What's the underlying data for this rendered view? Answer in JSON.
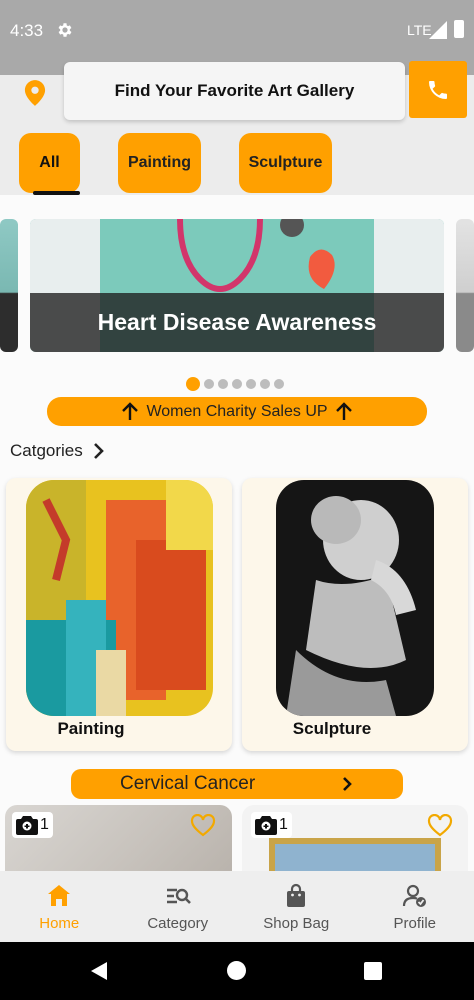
{
  "status_bar": {
    "time": "4:33",
    "network": "LTE"
  },
  "header": {
    "search_placeholder": "Find Your Favorite Art Gallery"
  },
  "filters": {
    "chips": [
      "All",
      "Painting",
      "Sculpture"
    ],
    "selected": "All"
  },
  "banner": {
    "title": "Heart Disease Awareness",
    "slide_count": 7,
    "active_slide": 1
  },
  "charity_button": {
    "label": "Women Charity Sales UP"
  },
  "categories": {
    "heading": "Catgories",
    "items": [
      {
        "label": "Painting"
      },
      {
        "label": "Sculpture"
      }
    ]
  },
  "cervical_button": {
    "label": "Cervical Cancer"
  },
  "products": [
    {
      "photo_count": "1",
      "favorite": false
    },
    {
      "photo_count": "1",
      "favorite": false
    }
  ],
  "bottom_nav": {
    "items": [
      {
        "label": "Home",
        "icon": "home-icon",
        "active": true
      },
      {
        "label": "Category",
        "icon": "category-search-icon",
        "active": false
      },
      {
        "label": "Shop Bag",
        "icon": "shopping-bag-icon",
        "active": false
      },
      {
        "label": "Profile",
        "icon": "profile-check-icon",
        "active": false
      }
    ]
  },
  "colors": {
    "accent": "#ffa000",
    "status_bar": "#a9a9a9",
    "header_bg": "#ececec"
  }
}
